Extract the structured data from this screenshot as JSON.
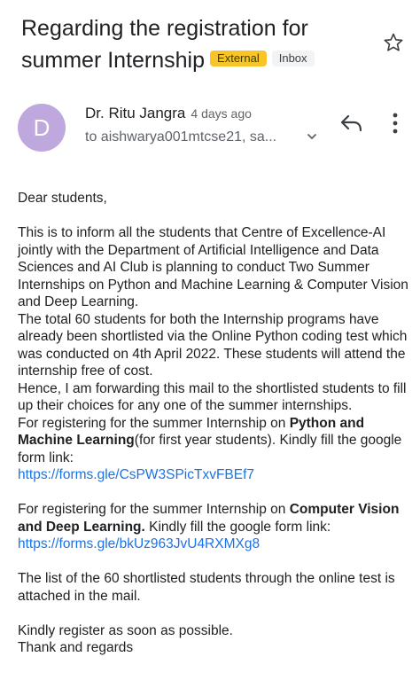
{
  "header": {
    "subject_line1": "Regarding the registration for",
    "subject_line2": "summer Internship",
    "label_external": "External",
    "label_inbox": "Inbox"
  },
  "sender": {
    "avatar_letter": "D",
    "name": "Dr. Ritu Jangra",
    "time": "4 days ago",
    "recipient": "to aishwarya001mtcse21, sa..."
  },
  "icons": {
    "star": "star-outline-icon",
    "reply": "reply-icon",
    "more": "more-vert-icon",
    "expand": "chevron-down-icon"
  },
  "body": {
    "greeting": "Dear students,",
    "para1": "This is to inform all the students that Centre of Excellence-AI jointly with the Department of Artificial Intelligence and Data Sciences and AI Club is planning to conduct Two Summer Internships on Python and Machine Learning & Computer Vision and Deep Learning.",
    "para2": "The total 60 students for both the Internship programs have already been shortlisted via the Online Python coding test which was conducted on 4th April 2022. These students will attend the internship free of cost.",
    "para3": "Hence, I am forwarding this mail to the shortlisted students to fill up their choices for any one of the summer internships.",
    "reg1_pre": "For registering for the summer Internship on ",
    "reg1_bold": "Python and Machine Learning",
    "reg1_post": "(for first year students). Kindly fill the google form link:",
    "link1": "https://forms.gle/CsPW3SPicTxvFBEf7",
    "reg2_pre": "For registering for the summer Internship on ",
    "reg2_bold": "Computer Vision and Deep Learning.",
    "reg2_post": " Kindly fill the google form link:",
    "link2": "https://forms.gle/bkUz963JvU4RXMXg8",
    "list_note": "The list of the 60 shortlisted students through the online test is attached in the mail.",
    "closing1": "Kindly register as soon as possible.",
    "closing2": "Thank and regards"
  },
  "colors": {
    "external_chip": "#f7c529",
    "avatar": "#bfa8de",
    "link": "#1a73e8"
  }
}
